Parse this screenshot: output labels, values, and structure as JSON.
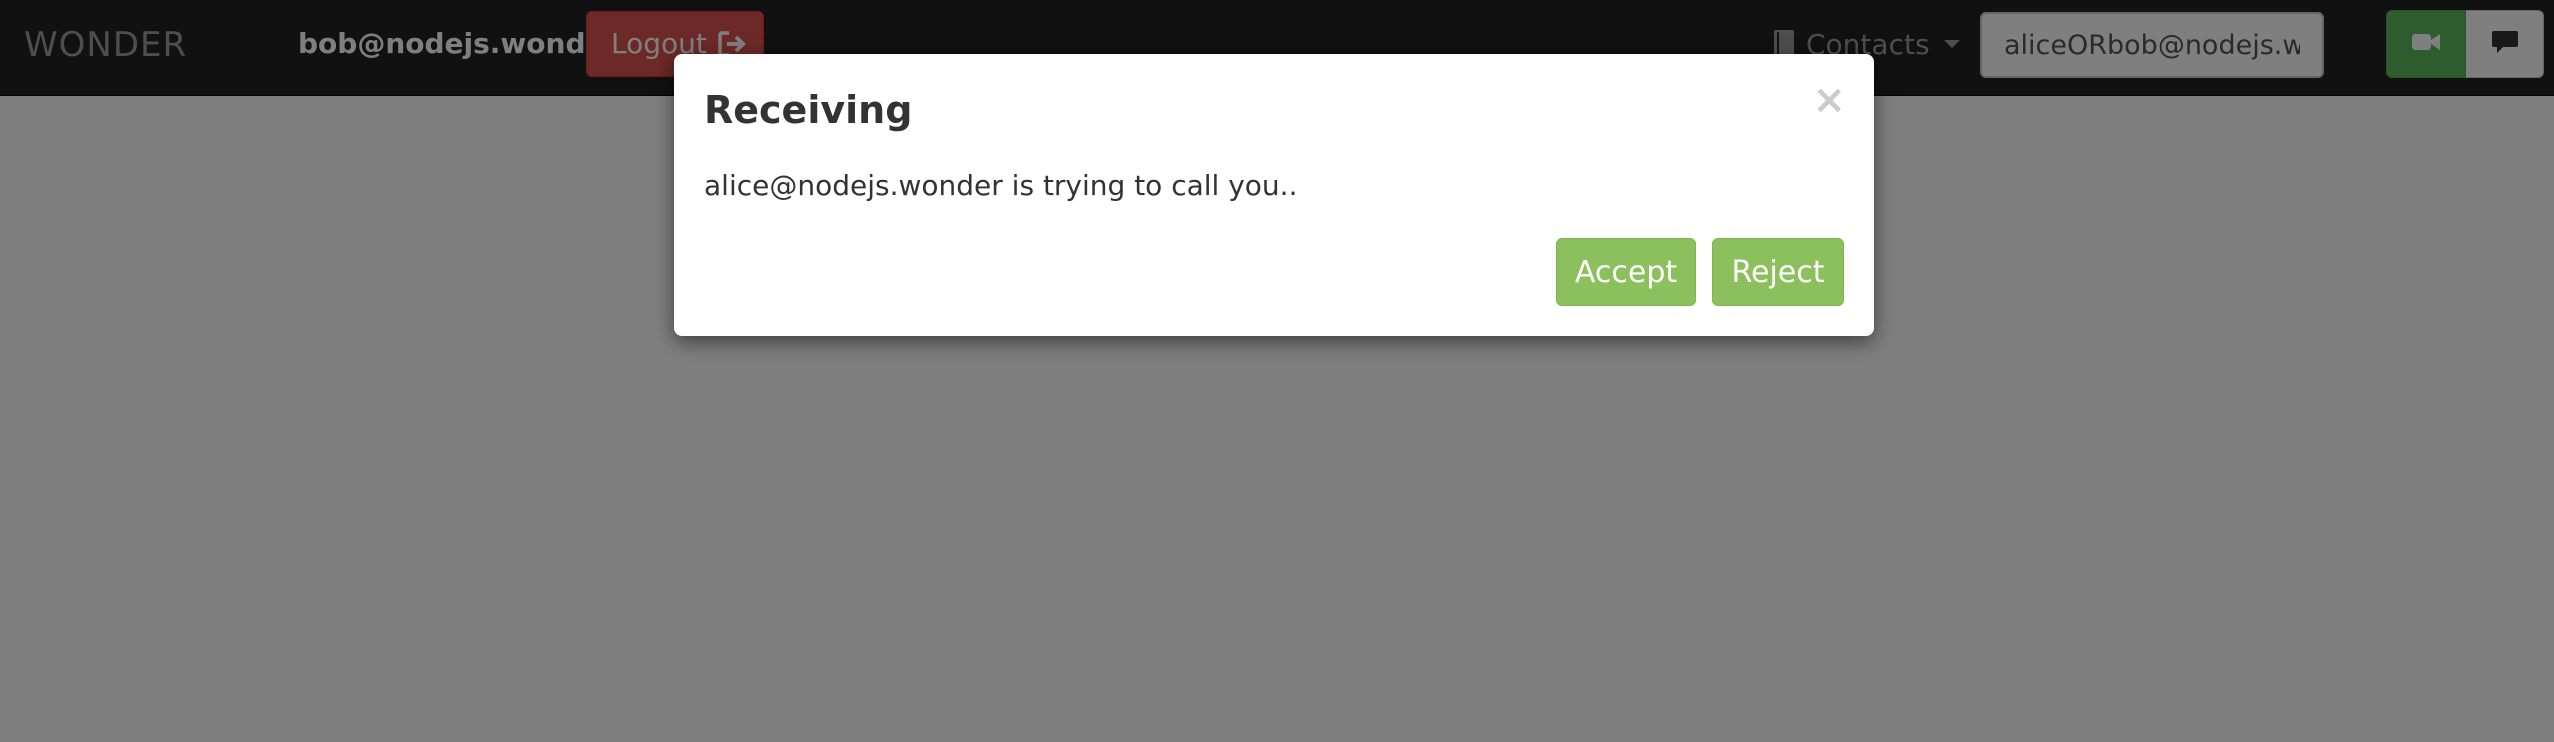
{
  "navbar": {
    "brand": "WONDER",
    "user_id": "bob@nodejs.wonder",
    "logout_label": "Logout",
    "contacts_label": "Contacts",
    "search": {
      "value": "aliceORbob@nodejs.wonder",
      "placeholder": ""
    },
    "icons": {
      "logout": "sign-out-icon",
      "contacts": "book-icon",
      "video_call": "video-camera-icon",
      "chat": "comment-icon"
    }
  },
  "modal": {
    "title": "Receiving",
    "close_symbol": "×",
    "message": "alice@nodejs.wonder is trying to call you..",
    "accept_label": "Accept",
    "reject_label": "Reject"
  },
  "colors": {
    "navbar_bg": "#222222",
    "logout_bg": "#d9534f",
    "video_btn_bg": "#5cb85c",
    "modal_btn_bg": "#8bc05c",
    "backdrop": "rgba(0,0,0,0.5)"
  }
}
